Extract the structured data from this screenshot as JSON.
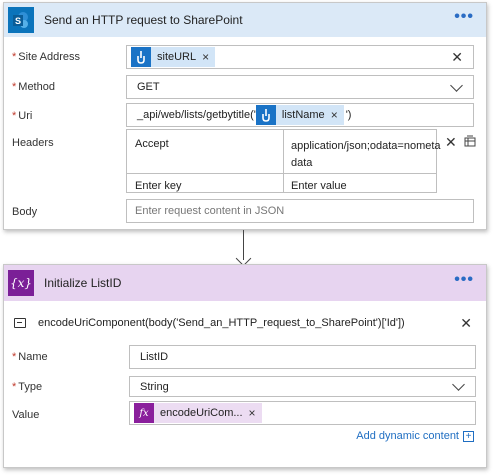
{
  "http_action": {
    "title": "Send an HTTP request to SharePoint",
    "more_label": "•••",
    "site_address": {
      "label": "Site Address",
      "token": "siteURL"
    },
    "method": {
      "label": "Method",
      "value": "GET"
    },
    "uri": {
      "label": "Uri",
      "prefix": "_api/web/lists/getbytitle('",
      "token": "listName",
      "suffix": "')"
    },
    "headers": {
      "label": "Headers",
      "key1": "Accept",
      "value1": "application/json;odata=nometa\ndata",
      "key_placeholder": "Enter key",
      "value_placeholder": "Enter value"
    },
    "body": {
      "label": "Body",
      "placeholder": "Enter request content in JSON"
    }
  },
  "init_action": {
    "title": "Initialize ListID",
    "icon_glyph": "{x}",
    "more_label": "•••",
    "comment": "encodeUriComponent(body('Send_an_HTTP_request_to_SharePoint')['Id'])",
    "name": {
      "label": "Name",
      "value": "ListID"
    },
    "type": {
      "label": "Type",
      "value": "String"
    },
    "value": {
      "label": "Value",
      "token": "encodeUriCom...",
      "fx_glyph": "fx"
    },
    "add_dynamic_content": "Add dynamic content",
    "plus_glyph": "+"
  },
  "required_marker": "*",
  "colors": {
    "sharepoint_blue": "#0b74bb",
    "variable_purple": "#7b1f97",
    "link_blue": "#1f6ec2"
  }
}
